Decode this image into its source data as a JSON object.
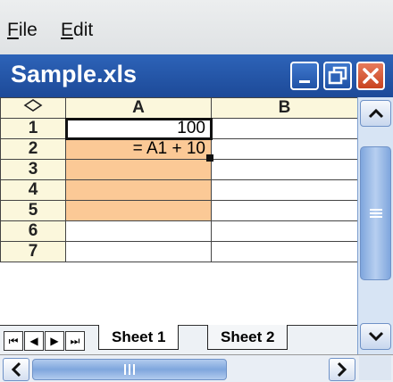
{
  "menu": {
    "items": [
      {
        "label": "File",
        "accel": "F",
        "rest": "ile"
      },
      {
        "label": "Edit",
        "accel": "E",
        "rest": "dit"
      }
    ]
  },
  "window": {
    "title": "Sample.xls",
    "buttons": [
      "minimize-icon",
      "restore-icon",
      "close-icon"
    ]
  },
  "grid": {
    "corner_icon": "select-all-icon",
    "columns": [
      "A",
      "B"
    ],
    "rows": [
      {
        "header": "1",
        "A": "100",
        "B": ""
      },
      {
        "header": "2",
        "A": "= A1 + 10",
        "B": ""
      },
      {
        "header": "3",
        "A": "",
        "B": ""
      },
      {
        "header": "4",
        "A": "",
        "B": ""
      },
      {
        "header": "5",
        "A": "",
        "B": ""
      },
      {
        "header": "6",
        "A": "",
        "B": ""
      },
      {
        "header": "7",
        "A": "",
        "B": ""
      }
    ],
    "selected_cell": "A1",
    "highlight_color": "#fbc996"
  },
  "sheets": {
    "tabs": [
      "Sheet 1",
      "Sheet 2"
    ],
    "active": "Sheet 1"
  },
  "colors": {
    "titlebar": "#1d4a98",
    "close_button": "#c8431f",
    "header_bg": "#fbf7dc"
  }
}
